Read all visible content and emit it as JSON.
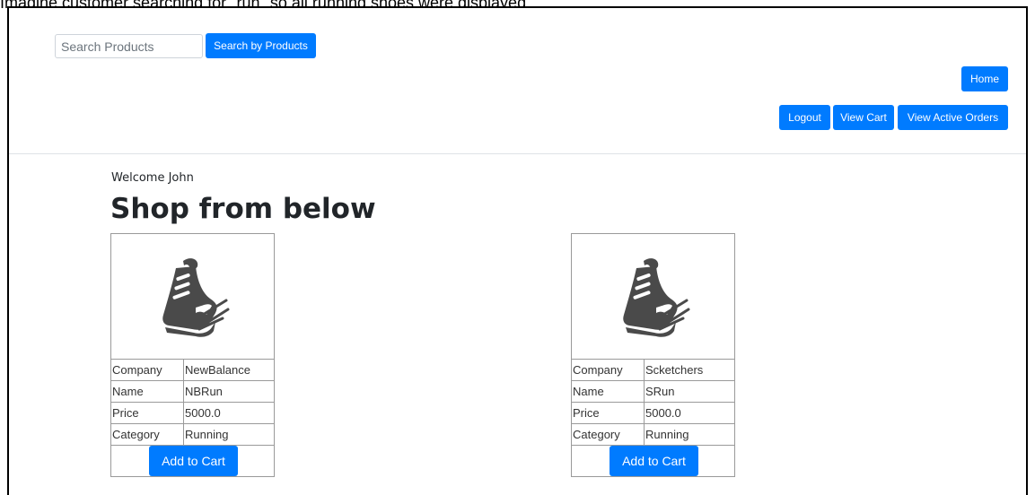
{
  "caption": "Imagine customer searching for \"run\" so all running shoes were displayed.",
  "search": {
    "placeholder": "Search Products",
    "button_label": "Search by Products"
  },
  "nav": {
    "home_label": "Home",
    "logout_label": "Logout",
    "view_cart_label": "View Cart",
    "active_orders_label": "View Active Orders"
  },
  "main": {
    "welcome": "Welcome John",
    "title": "Shop from below"
  },
  "products": [
    {
      "icon": "running-shoe-icon",
      "rows": [
        {
          "key": "Company",
          "value": "NewBalance"
        },
        {
          "key": "Name",
          "value": "NBRun"
        },
        {
          "key": "Price",
          "value": "5000.0"
        },
        {
          "key": "Category",
          "value": "Running"
        }
      ],
      "button_label": "Add to Cart"
    },
    {
      "icon": "running-shoe-icon",
      "rows": [
        {
          "key": "Company",
          "value": "Scketchers"
        },
        {
          "key": "Name",
          "value": "SRun"
        },
        {
          "key": "Price",
          "value": "5000.0"
        },
        {
          "key": "Category",
          "value": "Running"
        }
      ],
      "button_label": "Add to Cart"
    }
  ],
  "colors": {
    "primary": "#007bff",
    "border": "#9a9a9a",
    "shoe": "#4a4a4a"
  }
}
